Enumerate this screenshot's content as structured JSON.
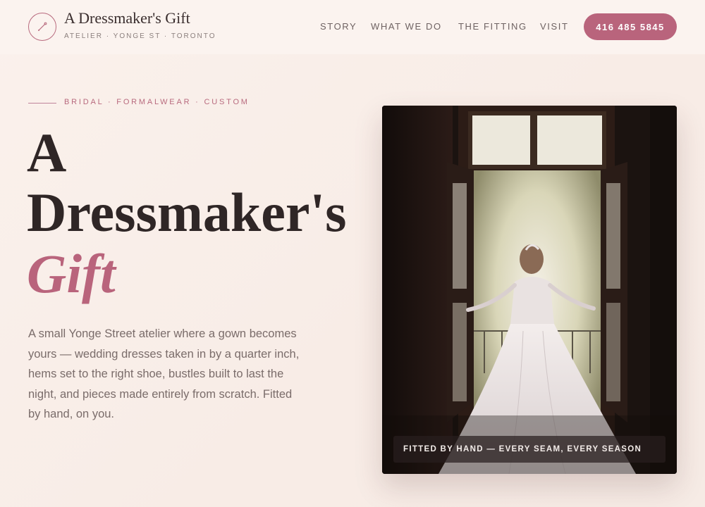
{
  "brand": {
    "name": "A Dressmaker's Gift",
    "subtitle": "ATELIER · YONGE ST · TORONTO",
    "logo_icon": "needle-icon"
  },
  "nav": {
    "items": [
      {
        "label": "STORY"
      },
      {
        "label": "WHAT WE DO"
      },
      {
        "label": "THE FITTING"
      },
      {
        "label": "VISIT"
      }
    ],
    "phone_label": "416 485 5845"
  },
  "hero": {
    "eyebrow": "BRIDAL · FORMALWEAR · CUSTOM",
    "title_line1": "A",
    "title_line2": "Dressmaker's",
    "title_line3": "Gift",
    "lede": "A small Yonge Street atelier where a gown becomes yours — wedding dresses taken in by a quarter inch, hems set to the right shoe, bustles built to last the night, and pieces made entirely from scratch. Fitted by hand, on you.",
    "photo_caption": "FITTED BY HAND — EVERY SEAM, EVERY SEASON"
  },
  "colors": {
    "accent": "#b9647c",
    "text_dark": "#2f2626",
    "background": "#faf1ec"
  }
}
